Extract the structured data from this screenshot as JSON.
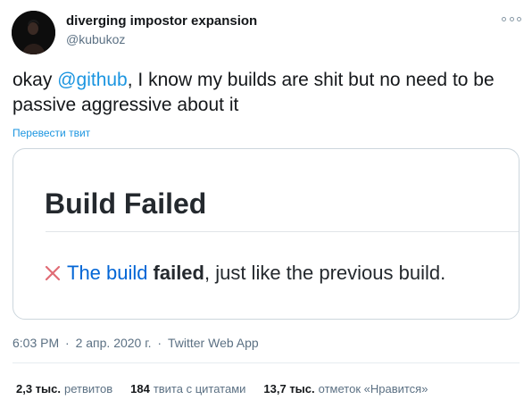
{
  "author": {
    "display_name": "diverging impostor expansion",
    "handle": "@kubukoz",
    "avatar_icon": "user-avatar-icon"
  },
  "more_icon": "more-options-icon",
  "tweet": {
    "prefix": "okay ",
    "mention": "@github",
    "suffix": ", I know my builds are shit but no need to be passive aggressive about it"
  },
  "translate_label": "Перевести твит",
  "card": {
    "title": "Build Failed",
    "status_icon": "close-x-icon",
    "link_text": "The build",
    "bold_text": "failed",
    "rest_text": ", just like the previous build."
  },
  "meta": {
    "time": "6:03 PM",
    "date": "2 апр. 2020 г.",
    "source": "Twitter Web App"
  },
  "stats": {
    "retweets_count": "2,3 тыс.",
    "retweets_label": "ретвитов",
    "quotes_count": "184",
    "quotes_label": "твита с цитатами",
    "likes_count": "13,7 тыс.",
    "likes_label": "отметок «Нравится»"
  },
  "colors": {
    "mention": "#1b95e0",
    "card_link": "#0366d6",
    "fail_x": "#e06c75",
    "muted": "#5b7083"
  }
}
